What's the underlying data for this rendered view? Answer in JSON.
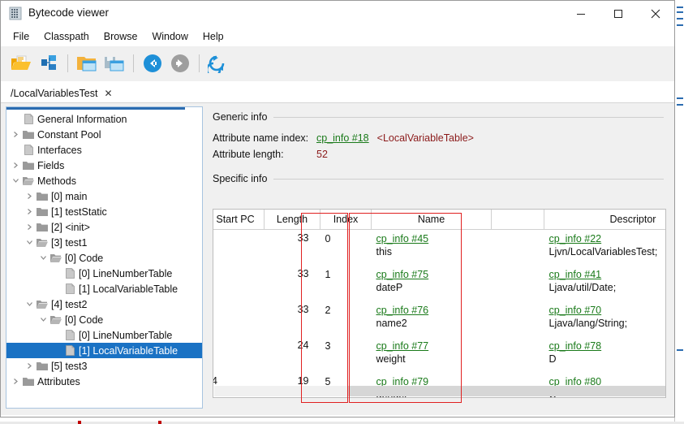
{
  "window": {
    "title": "Bytecode viewer",
    "icon": "app-icon",
    "controls": {
      "minimize": "—",
      "maximize": "☐",
      "close": "✕"
    }
  },
  "menubar": {
    "items": [
      {
        "label": "File"
      },
      {
        "label": "Classpath"
      },
      {
        "label": "Browse"
      },
      {
        "label": "Window"
      },
      {
        "label": "Help"
      }
    ]
  },
  "toolbar": {
    "buttons": [
      {
        "name": "open-class-file-icon"
      },
      {
        "name": "browse-classpath-icon"
      },
      {
        "name": "open-window-icon"
      },
      {
        "name": "save-window-icon"
      },
      {
        "name": "back-arrow-icon"
      },
      {
        "name": "forward-arrow-icon"
      },
      {
        "name": "reload-icon"
      }
    ]
  },
  "tabs": [
    {
      "label": "/LocalVariablesTest",
      "close": "✕",
      "active": true
    }
  ],
  "tree": {
    "items": [
      {
        "twisty": "",
        "indent": 0,
        "icon": "attribute-icon",
        "label": "General Information",
        "selected": false
      },
      {
        "twisty": ">",
        "indent": 0,
        "icon": "folder-icon",
        "label": "Constant Pool",
        "selected": false
      },
      {
        "twisty": "",
        "indent": 0,
        "icon": "attribute-icon",
        "label": "Interfaces",
        "selected": false
      },
      {
        "twisty": ">",
        "indent": 0,
        "icon": "folder-icon",
        "label": "Fields",
        "selected": false
      },
      {
        "twisty": "v",
        "indent": 0,
        "icon": "folder-open-icon",
        "label": "Methods",
        "selected": false
      },
      {
        "twisty": ">",
        "indent": 1,
        "icon": "folder-icon",
        "label": "[0] main",
        "selected": false
      },
      {
        "twisty": ">",
        "indent": 1,
        "icon": "folder-icon",
        "label": "[1] testStatic",
        "selected": false
      },
      {
        "twisty": ">",
        "indent": 1,
        "icon": "folder-icon",
        "label": "[2] <init>",
        "selected": false
      },
      {
        "twisty": "v",
        "indent": 1,
        "icon": "folder-open-icon",
        "label": "[3] test1",
        "selected": false
      },
      {
        "twisty": "v",
        "indent": 2,
        "icon": "folder-open-icon",
        "label": "[0] Code",
        "selected": false
      },
      {
        "twisty": "",
        "indent": 3,
        "icon": "attribute-icon",
        "label": "[0] LineNumberTable",
        "selected": false
      },
      {
        "twisty": "",
        "indent": 3,
        "icon": "attribute-icon",
        "label": "[1] LocalVariableTable",
        "selected": false
      },
      {
        "twisty": "v",
        "indent": 1,
        "icon": "folder-open-icon",
        "label": "[4] test2",
        "selected": false
      },
      {
        "twisty": "v",
        "indent": 2,
        "icon": "folder-open-icon",
        "label": "[0] Code",
        "selected": false
      },
      {
        "twisty": "",
        "indent": 3,
        "icon": "attribute-icon",
        "label": "[0] LineNumberTable",
        "selected": false
      },
      {
        "twisty": "",
        "indent": 3,
        "icon": "attribute-icon",
        "label": "[1] LocalVariableTable",
        "selected": true
      },
      {
        "twisty": ">",
        "indent": 1,
        "icon": "folder-icon",
        "label": "[5] test3",
        "selected": false
      },
      {
        "twisty": ">",
        "indent": 0,
        "icon": "folder-icon",
        "label": "Attributes",
        "selected": false
      }
    ]
  },
  "detail": {
    "generic_section_label": "Generic info",
    "specific_section_label": "Specific info",
    "attribute_name_index": {
      "label": "Attribute name index:",
      "link": "cp_info #18",
      "value": "<LocalVariableTable>"
    },
    "attribute_length": {
      "label": "Attribute length:",
      "value": "52"
    },
    "table": {
      "columns": [
        "Start PC",
        "Length",
        "Index",
        "Name",
        "",
        "Descriptor"
      ],
      "rows": [
        {
          "start_pc": "",
          "length": "33",
          "index": "0",
          "name_link": "cp_info #45",
          "name": "this",
          "desc_link": "cp_info #22",
          "desc": "Ljvn/LocalVariablesTest;"
        },
        {
          "start_pc": "",
          "length": "33",
          "index": "1",
          "name_link": "cp_info #75",
          "name": "dateP",
          "desc_link": "cp_info #41",
          "desc": "Ljava/util/Date;"
        },
        {
          "start_pc": "",
          "length": "33",
          "index": "2",
          "name_link": "cp_info #76",
          "name": "name2",
          "desc_link": "cp_info #70",
          "desc": "Ljava/lang/String;"
        },
        {
          "start_pc": "",
          "length": "24",
          "index": "3",
          "name_link": "cp_info #77",
          "name": "weight",
          "desc_link": "cp_info #78",
          "desc": "D"
        },
        {
          "start_pc": "4",
          "length": "19",
          "index": "5",
          "name_link": "cp_info #79",
          "name": "gender",
          "desc_link": "cp_info #80",
          "desc": "C"
        }
      ]
    }
  },
  "annotations": {
    "highlight_color": "#e02020",
    "boxes": [
      {
        "name": "index-column-highlight"
      },
      {
        "name": "name-column-highlight"
      }
    ]
  }
}
